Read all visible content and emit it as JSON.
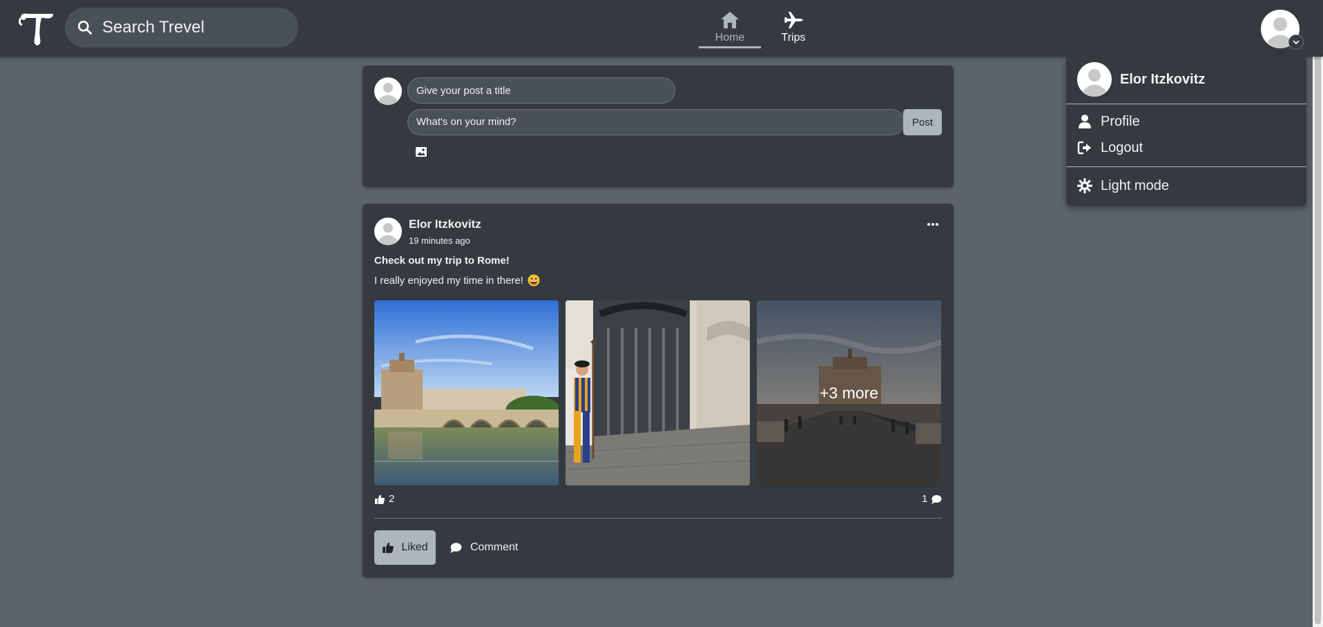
{
  "app": {
    "name": "Trevel"
  },
  "search": {
    "placeholder": "Search Trevel"
  },
  "nav": {
    "home": "Home",
    "trips": "Trips"
  },
  "user_menu": {
    "name": "Elor Itzkovitz",
    "items": [
      {
        "label": "Profile",
        "icon": "user-icon"
      },
      {
        "label": "Logout",
        "icon": "logout-icon"
      },
      {
        "label": "Light mode",
        "icon": "sun-icon"
      }
    ]
  },
  "composer": {
    "title_placeholder": "Give your post a title",
    "body_placeholder": "What's on your mind?",
    "post_label": "Post"
  },
  "post": {
    "author": "Elor Itzkovitz",
    "time": "19 minutes ago",
    "title": "Check out my trip to Rome!",
    "body": "I really enjoyed my time in there!",
    "more_photos": "+3 more",
    "likes": "2",
    "comments": "1",
    "liked_label": "Liked",
    "comment_label": "Comment"
  },
  "colors": {
    "page_bg": "#5c636b",
    "panel_bg": "#343a40",
    "accent": "#adb5bd"
  }
}
